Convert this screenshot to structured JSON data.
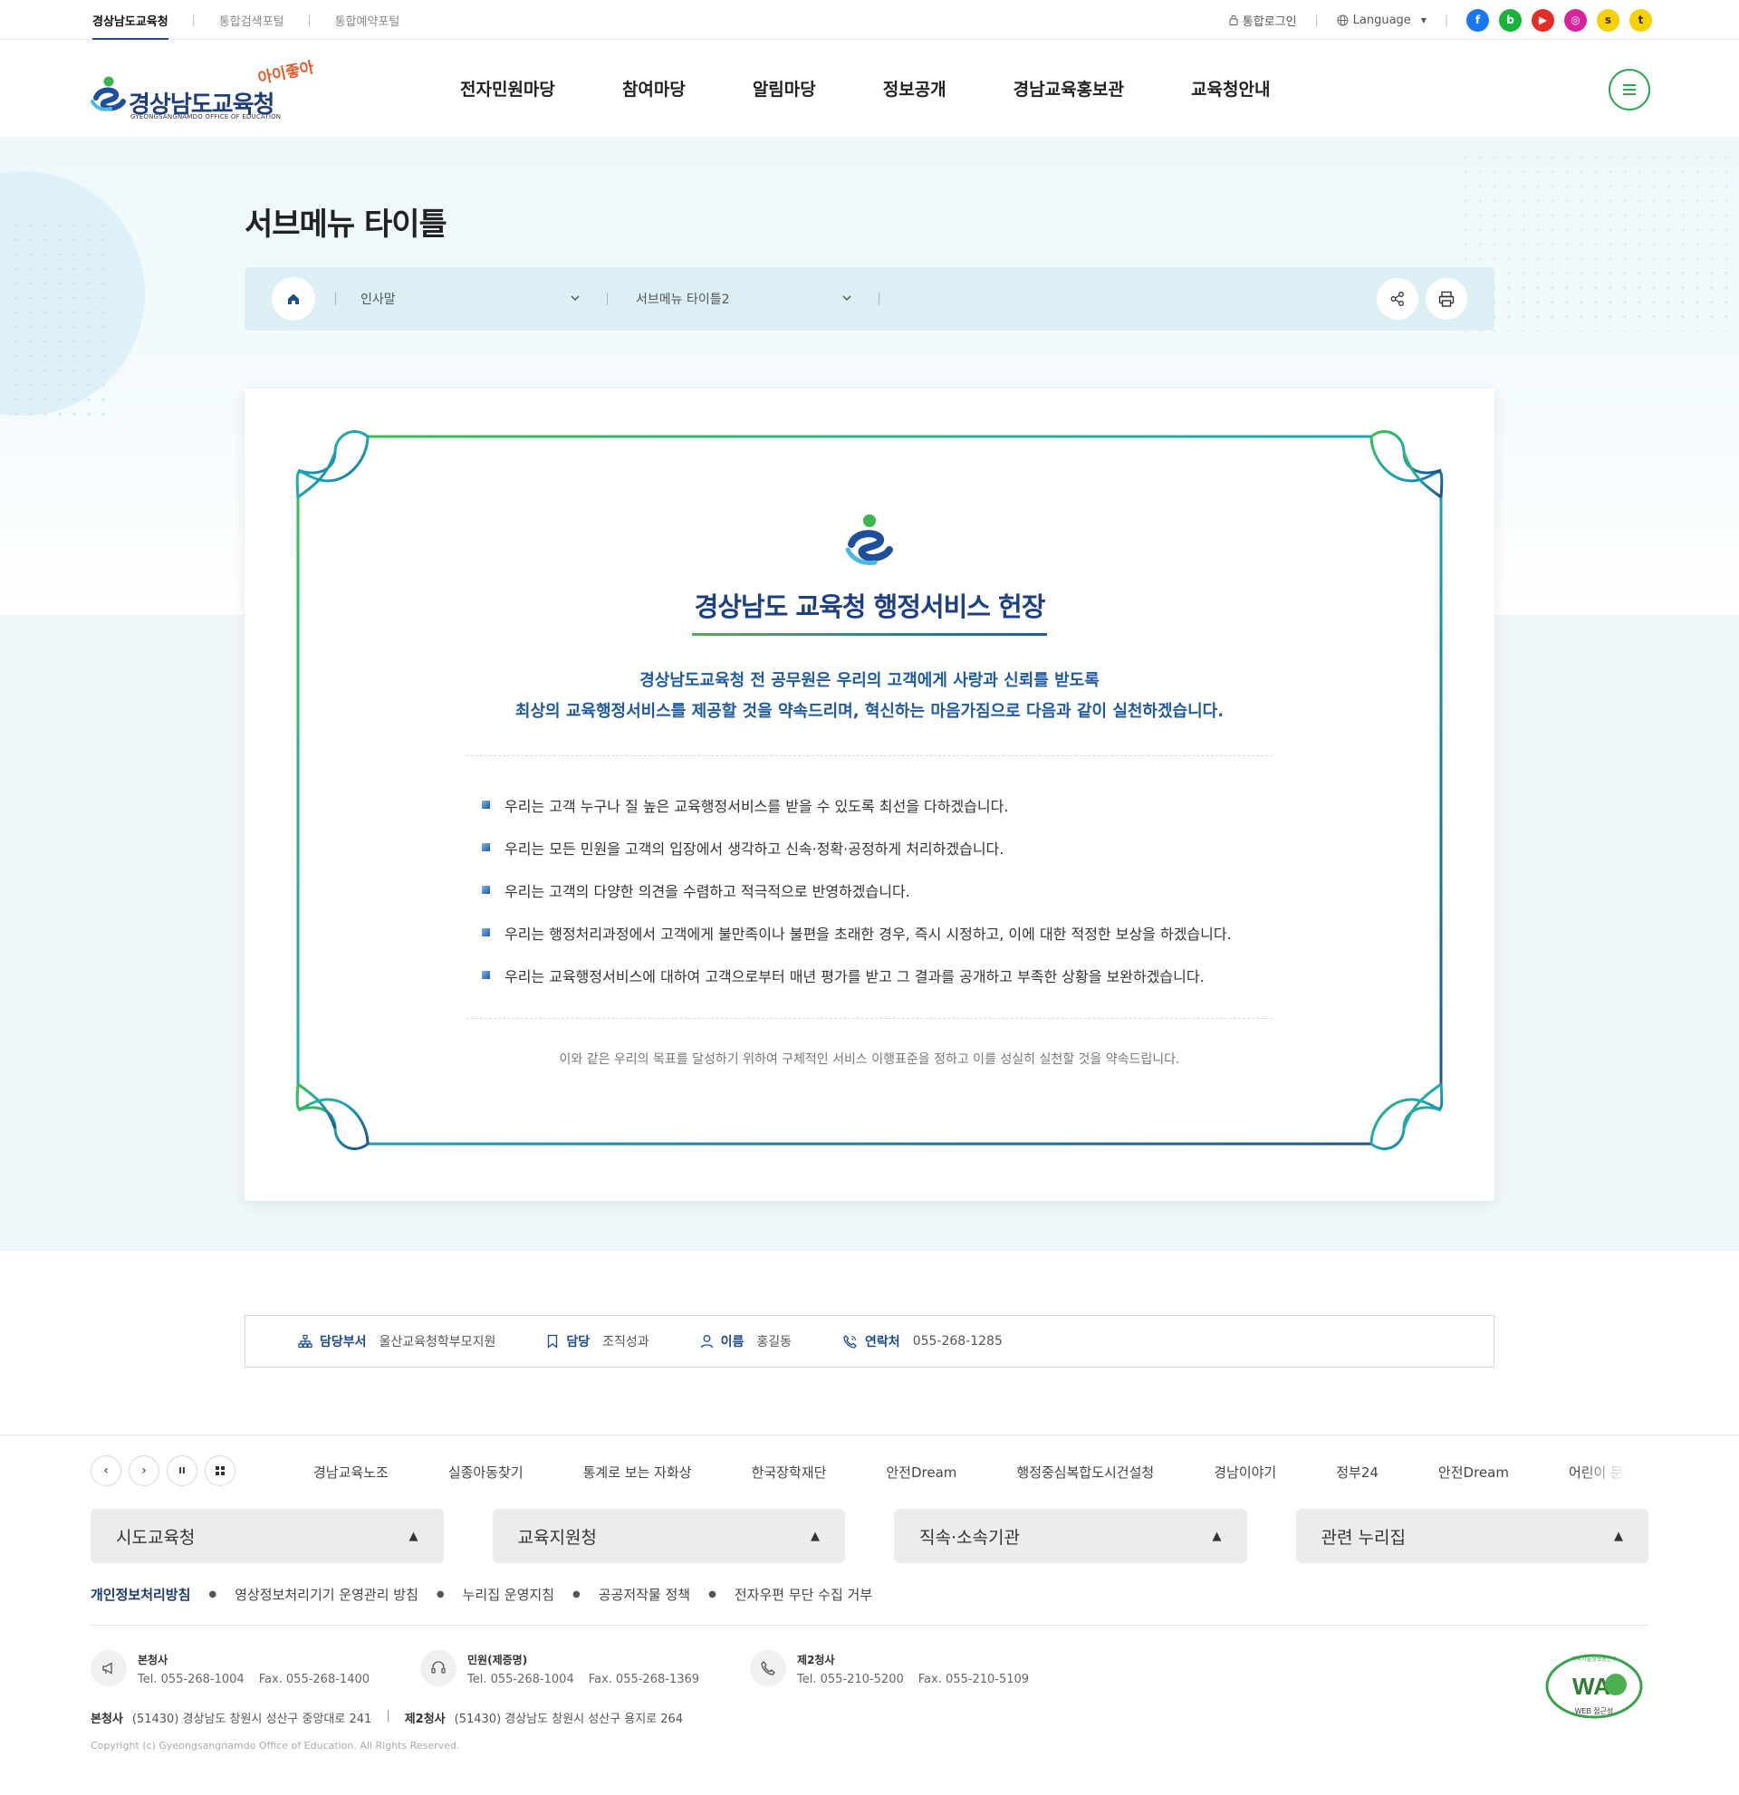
{
  "top_tabs": [
    "경상남도교육청",
    "통합검색포털",
    "통합예약포털"
  ],
  "utility": {
    "login": "통합로그인",
    "language": "Language"
  },
  "social": [
    {
      "name": "facebook-icon",
      "color": "#1877f2",
      "glyph": "f"
    },
    {
      "name": "blog-icon",
      "color": "#19b33c",
      "glyph": "b"
    },
    {
      "name": "youtube-icon",
      "color": "#e52d27",
      "glyph": "▶"
    },
    {
      "name": "instagram-icon",
      "color": "#d6249f",
      "glyph": "◎"
    },
    {
      "name": "kakaostory-icon",
      "color": "#f7d000",
      "glyph": "s"
    },
    {
      "name": "kakaotalk-icon",
      "color": "#f7d000",
      "glyph": "t"
    }
  ],
  "logo": {
    "name": "경상남도교육청",
    "en": "GYEONGSANGNAMDO OFFICE OF EDUCATION",
    "slogan": "아이좋아"
  },
  "gnb": [
    "전자민원마당",
    "참여마당",
    "알림마당",
    "정보공개",
    "경남교육홍보관",
    "교육청안내"
  ],
  "page_title": "서브메뉴 타이틀",
  "breadcrumb": {
    "level1": "인사말",
    "level2": "서브메뉴 타이틀2"
  },
  "card": {
    "title": "경상남도 교육청 행정서비스 헌장",
    "intro_line1": "경상남도교육청 전 공무원은 우리의 고객에게 사랑과 신뢰를 받도록",
    "intro_line2": "최상의 교육행정서비스를 제공할 것을 약속드리며, 혁신하는 마음가짐으로 다음과 같이 실천하겠습니다.",
    "pledges": [
      "우리는 고객 누구나 질 높은 교육행정서비스를 받을 수 있도록 최선을 다하겠습니다.",
      "우리는 모든 민원을 고객의 입장에서 생각하고 신속·정확·공정하게 처리하겠습니다.",
      "우리는 고객의 다양한 의견을 수렴하고 적극적으로 반영하겠습니다.",
      "우리는 행정처리과정에서 고객에게 불만족이나 불편을 초래한 경우, 즉시 시정하고, 이에 대한 적정한 보상을 하겠습니다.",
      "우리는 교육행정서비스에 대하여 고객으로부터 매년 평가를 받고 그 결과를 공개하고 부족한 상황을 보완하겠습니다."
    ],
    "closing": "이와 같은 우리의 목표를 달성하기 위하여 구체적인 서비스 이행표준을 정하고 이를 성실히 실천할 것을 약속드립니다."
  },
  "info": {
    "dept_label": "담당부서",
    "dept": "울산교육청학부모지원",
    "manager_label": "담당",
    "manager": "조직성과",
    "name_label": "이름",
    "name": "홍길동",
    "contact_label": "연락처",
    "contact": "055-268-1285"
  },
  "banners": [
    "경남교육노조",
    "실종아동찾기",
    "통계로 보는 자화상",
    "한국장학재단",
    "안전Dream",
    "행정중심복합도시건설청",
    "경남이야기",
    "정부24",
    "안전Dream",
    "어린이 문화"
  ],
  "sites": [
    "시도교육청",
    "교육지원청",
    "직속·소속기관",
    "관련 누리집"
  ],
  "policy": [
    "개인정보처리방침",
    "영상정보처리기기 운영관리 방침",
    "누리집 운영지침",
    "공공저작물 정책",
    "전자우편 무단 수집 거부"
  ],
  "contacts": [
    {
      "title": "본청사",
      "tel": "Tel. 055-268-1004",
      "fax": "Fax. 055-268-1400"
    },
    {
      "title": "민원(제증명)",
      "tel": "Tel. 055-268-1004",
      "fax": "Fax. 055-268-1369"
    },
    {
      "title": "제2청사",
      "tel": "Tel. 055-210-5200",
      "fax": "Fax. 055-210-5109"
    }
  ],
  "address": {
    "main_label": "본청사",
    "main": "(51430) 경상남도 창원시 성산구 중앙대로 241",
    "second_label": "제2청사",
    "second": "(51430) 경상남도 창원시 성산구 용지로 264"
  },
  "copyright": "Copyright (c) Gyeongsangnamdo Office of Education. All Rights Reserved.",
  "wa_mark": {
    "text": "WA",
    "sub": "WEB 접근성",
    "ring": "과학기술정보통신부"
  }
}
